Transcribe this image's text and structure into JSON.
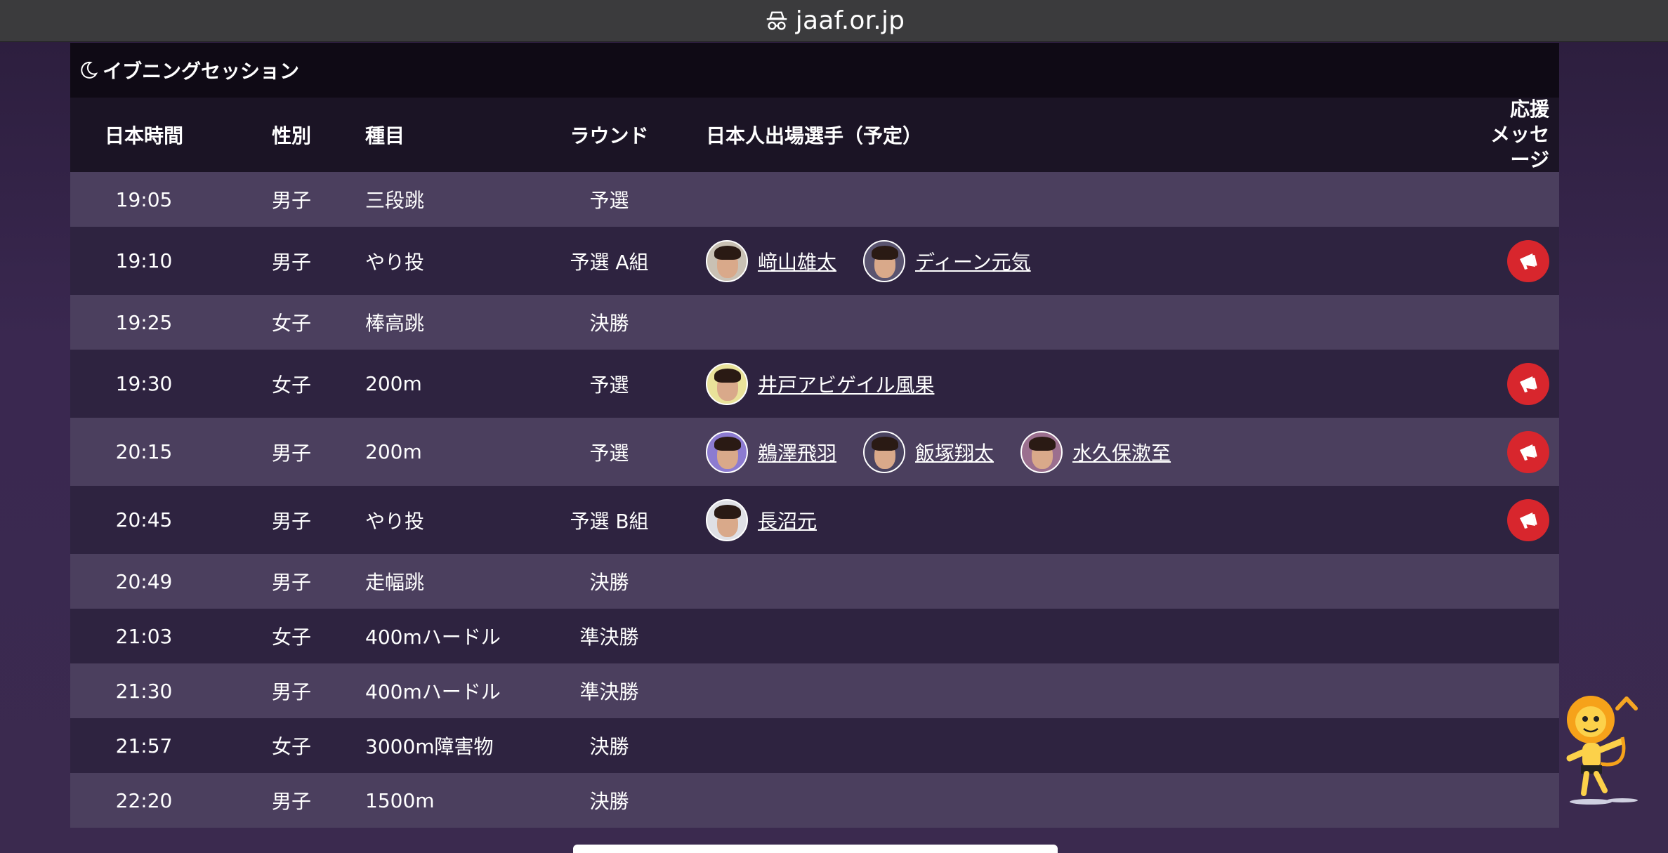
{
  "browser": {
    "url": "jaaf.or.jp"
  },
  "session": {
    "title": "イブニングセッション",
    "icon": "moon-icon"
  },
  "columns": {
    "time": "日本時間",
    "gender": "性別",
    "event": "種目",
    "round": "ラウンド",
    "athletes": "日本人出場選手（予定）",
    "cheer_line1": "応援",
    "cheer_line2": "メッセージ"
  },
  "rows": [
    {
      "time": "19:05",
      "gender": "男子",
      "event": "三段跳",
      "round": "予選",
      "athletes": [],
      "cheer": false
    },
    {
      "time": "19:10",
      "gender": "男子",
      "event": "やり投",
      "round": "予選 A組",
      "athletes": [
        "﨑山雄太",
        "ディーン元気"
      ],
      "cheer": true
    },
    {
      "time": "19:25",
      "gender": "女子",
      "event": "棒高跳",
      "round": "決勝",
      "athletes": [],
      "cheer": false
    },
    {
      "time": "19:30",
      "gender": "女子",
      "event": "200m",
      "round": "予選",
      "athletes": [
        "井戸アビゲイル風果"
      ],
      "cheer": true
    },
    {
      "time": "20:15",
      "gender": "男子",
      "event": "200m",
      "round": "予選",
      "athletes": [
        "鵜澤飛羽",
        "飯塚翔太",
        "水久保漱至"
      ],
      "cheer": true
    },
    {
      "time": "20:45",
      "gender": "男子",
      "event": "やり投",
      "round": "予選 B組",
      "athletes": [
        "長沼元"
      ],
      "cheer": true
    },
    {
      "time": "20:49",
      "gender": "男子",
      "event": "走幅跳",
      "round": "決勝",
      "athletes": [],
      "cheer": false
    },
    {
      "time": "21:03",
      "gender": "女子",
      "event": "400mハードル",
      "round": "準決勝",
      "athletes": [],
      "cheer": false
    },
    {
      "time": "21:30",
      "gender": "男子",
      "event": "400mハードル",
      "round": "準決勝",
      "athletes": [],
      "cheer": false
    },
    {
      "time": "21:57",
      "gender": "女子",
      "event": "3000m障害物",
      "round": "決勝",
      "athletes": [],
      "cheer": false
    },
    {
      "time": "22:20",
      "gender": "男子",
      "event": "1500m",
      "round": "決勝",
      "athletes": [],
      "cheer": false
    }
  ],
  "colors": {
    "accent": "#d8262d",
    "row_light": "#4b3f5e",
    "row_dark": "#2e2340",
    "scroll_arrow": "#f5a623"
  },
  "icons": {
    "cheer": "megaphone-icon",
    "scroll_top": "chevron-up-icon",
    "mascot": "lion-mascot-icon",
    "url": "privacy-icon"
  }
}
